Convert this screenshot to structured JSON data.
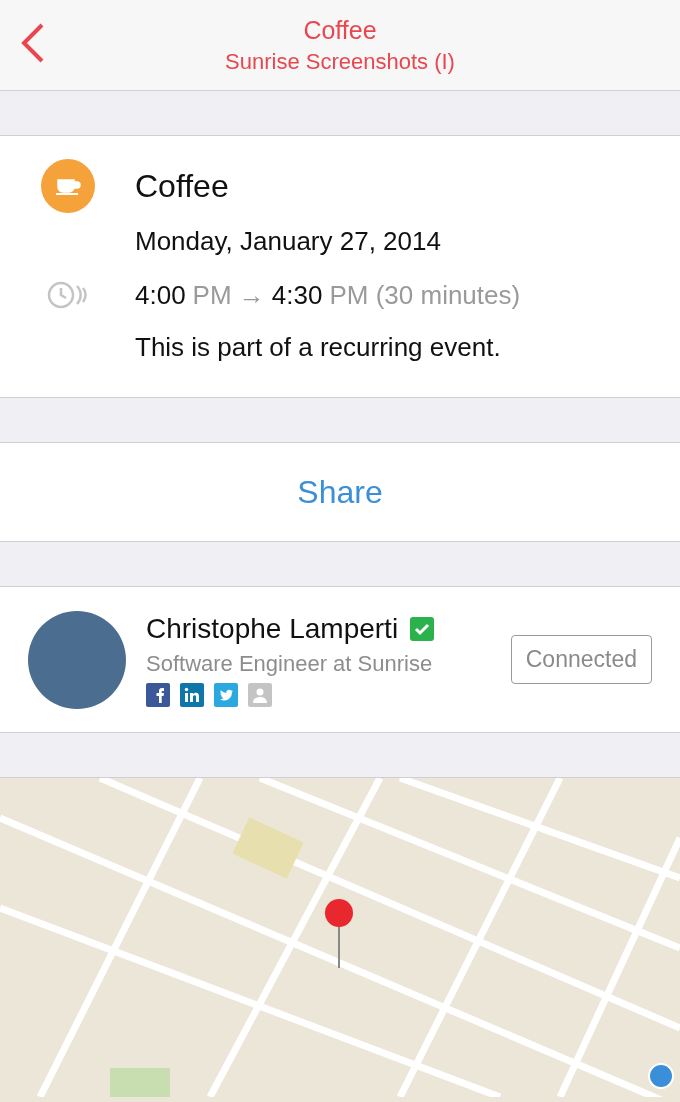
{
  "header": {
    "title": "Coffee",
    "subtitle": "Sunrise Screenshots (I)"
  },
  "event": {
    "title": "Coffee",
    "date": "Monday, January 27, 2014",
    "time": [
      {
        "text": "4:00",
        "muted": false
      },
      {
        "text": "PM →",
        "muted": true
      },
      {
        "text": "4:30",
        "muted": false
      },
      {
        "text": "PM (30 minutes)",
        "muted": true
      }
    ],
    "note": "This is part of a recurring event."
  },
  "share": {
    "label": "Share"
  },
  "person": {
    "name": "Christophe Lamperti",
    "verified": true,
    "role": "Software Engineer at Sunrise",
    "networks": [
      {
        "kind": "facebook"
      },
      {
        "kind": "linkedin"
      },
      {
        "kind": "twitter"
      },
      {
        "kind": "contact"
      }
    ],
    "button": "Connected"
  }
}
